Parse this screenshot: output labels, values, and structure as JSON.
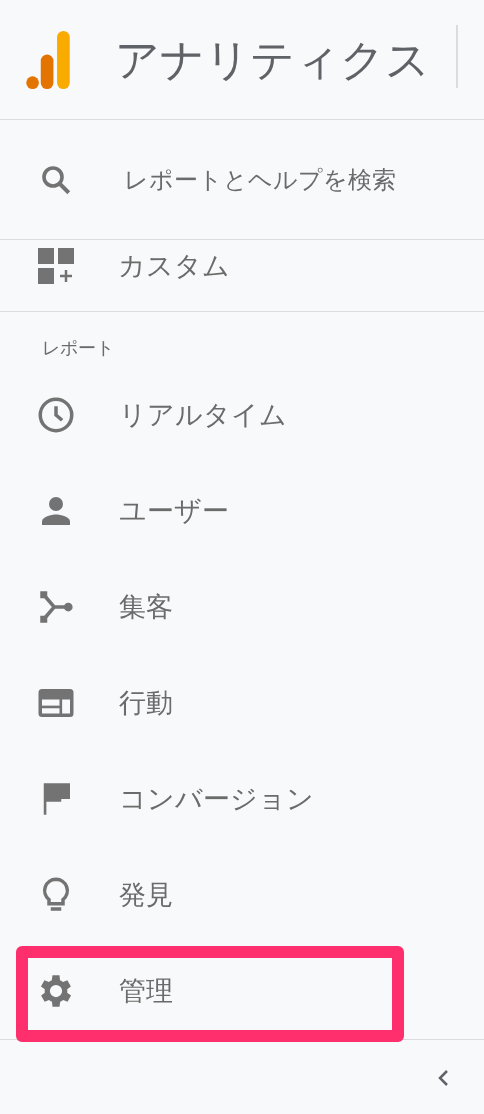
{
  "header": {
    "title": "アナリティクス"
  },
  "search": {
    "placeholder": "レポートとヘルプを検索"
  },
  "custom": {
    "label": "カスタム"
  },
  "section": {
    "label": "レポート"
  },
  "items": [
    {
      "kind": "clock",
      "label": "リアルタイム",
      "highlighted": false
    },
    {
      "kind": "person",
      "label": "ユーザー",
      "highlighted": false
    },
    {
      "kind": "fork",
      "label": "集客",
      "highlighted": false
    },
    {
      "kind": "layout",
      "label": "行動",
      "highlighted": false
    },
    {
      "kind": "flag",
      "label": "コンバージョン",
      "highlighted": false
    },
    {
      "kind": "bulb",
      "label": "発見",
      "highlighted": false
    },
    {
      "kind": "gear",
      "label": "管理",
      "highlighted": true
    }
  ]
}
